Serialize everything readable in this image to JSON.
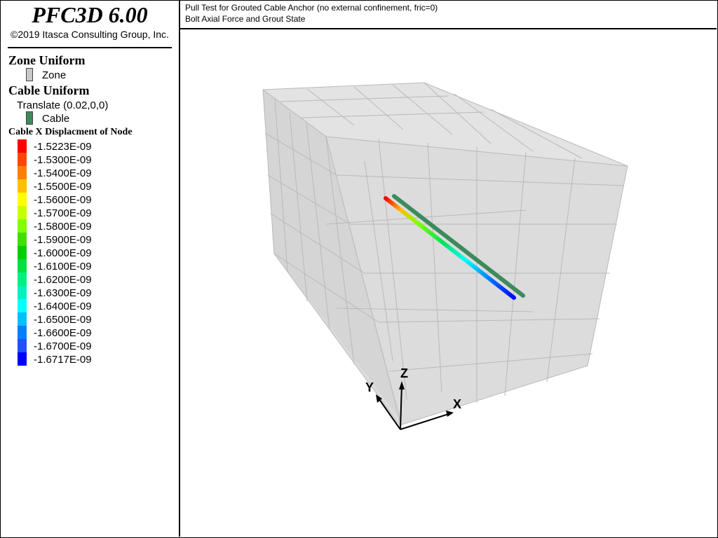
{
  "app": {
    "title": "PFC3D 6.00",
    "copyright": "©2019 Itasca Consulting Group, Inc."
  },
  "header": {
    "title": "Pull Test for Grouted Cable Anchor (no external confinement, fric=0)",
    "subtitle": "Bolt Axial Force and Grout State"
  },
  "legend": {
    "zone": {
      "heading": "Zone Uniform",
      "item_label": "Zone",
      "color": "#c8c8c8"
    },
    "cable": {
      "heading": "Cable Uniform",
      "translate_label": "Translate (0.02,0,0)",
      "item_label": "Cable",
      "color": "#3d8a5c"
    },
    "contour": {
      "title": "Cable X Displacment of Node",
      "labels": [
        "-1.5223E-09",
        "-1.5300E-09",
        "-1.5400E-09",
        "-1.5500E-09",
        "-1.5600E-09",
        "-1.5700E-09",
        "-1.5800E-09",
        "-1.5900E-09",
        "-1.6000E-09",
        "-1.6100E-09",
        "-1.6200E-09",
        "-1.6300E-09",
        "-1.6400E-09",
        "-1.6500E-09",
        "-1.6600E-09",
        "-1.6700E-09",
        "-1.6717E-09"
      ],
      "colors": [
        "#ff0000",
        "#ff4500",
        "#ff8000",
        "#ffbf00",
        "#ffff00",
        "#c8ff00",
        "#80ff00",
        "#40e000",
        "#00d000",
        "#00e040",
        "#00f080",
        "#00f0c0",
        "#00ffff",
        "#00c0ff",
        "#0080ff",
        "#2050ff",
        "#0000ff"
      ]
    }
  },
  "axes": {
    "x_label": "X",
    "y_label": "Y",
    "z_label": "Z"
  }
}
